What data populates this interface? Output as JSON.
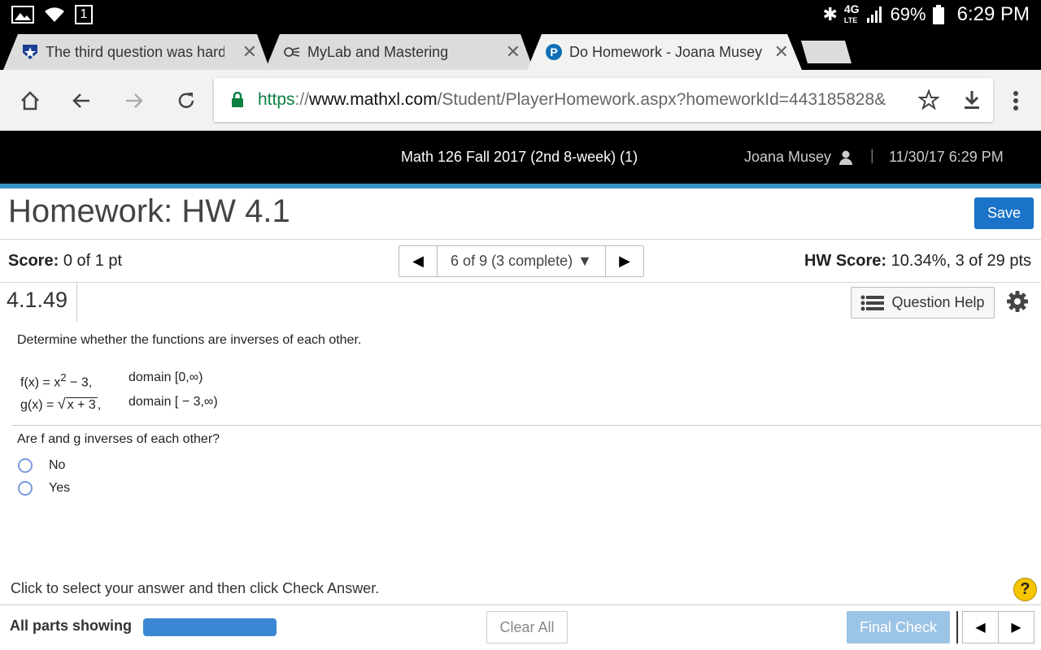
{
  "status": {
    "notif_count": "1",
    "network": "4G",
    "network_sub": "LTE",
    "battery": "69%",
    "time": "6:29 PM"
  },
  "tabs": [
    {
      "title": "The third question was hard to",
      "icon": "star-shield-icon"
    },
    {
      "title": "MyLab and Mastering",
      "icon": "mylab-icon"
    },
    {
      "title": "Do Homework - Joana Musey",
      "icon": "pearson-icon"
    }
  ],
  "address": {
    "scheme": "https",
    "sep": "://",
    "host": "www.mathxl.com",
    "path": "/Student/PlayerHomework.aspx?homeworkId=443185828&"
  },
  "course": {
    "title": "Math 126 Fall 2017 (2nd 8-week) (1)",
    "user": "Joana Musey",
    "separator": "|",
    "datetime": "11/30/17 6:29 PM"
  },
  "header": {
    "title": "Homework: HW 4.1",
    "save_label": "Save"
  },
  "score": {
    "label": "Score:",
    "value": "0 of 1 pt"
  },
  "question_nav": {
    "selected": "6 of 9 (3 complete)",
    "prev": "◀",
    "next": "▶",
    "dropdown": "▼"
  },
  "hw_score": {
    "label": "HW Score:",
    "value": "10.34%, 3 of 29 pts"
  },
  "question": {
    "number": "4.1.49",
    "help_label": "Question Help",
    "prompt": "Determine whether the functions are inverses of each other.",
    "f_lhs": "f(x) = x",
    "f_exp": "2",
    "f_rhs": " − 3,",
    "f_domain": "domain [0,∞)",
    "g_lhs": "g(x) = ",
    "g_radicand": "x + 3",
    "g_rhs": ",",
    "g_domain": "domain [ − 3,∞)",
    "ask": "Are f and g inverses of each other?",
    "options": [
      "No",
      "Yes"
    ]
  },
  "footer": {
    "hint": "Click to select your answer and then click Check Answer.",
    "help": "?",
    "all_parts": "All parts showing",
    "progress_fraction": 1.0,
    "clear_label": "Clear All",
    "final_label": "Final Check",
    "prev": "◀",
    "next": "▶"
  }
}
